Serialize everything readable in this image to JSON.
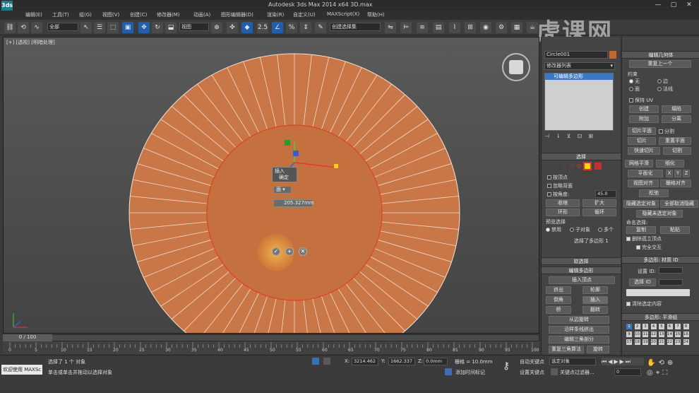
{
  "window": {
    "title": "Autodesk 3ds Max  2014 x64     3D.max",
    "logo": "3ds",
    "controls": [
      "—",
      "▢",
      "✕"
    ]
  },
  "menu": [
    "编辑(E)",
    "工具(T)",
    "组(G)",
    "视图(V)",
    "创建(C)",
    "修改器(M)",
    "动画(A)",
    "图形编辑器(D)",
    "渲染(R)",
    "自定义(U)",
    "MAXScript(X)",
    "帮助(H)"
  ],
  "toolbar": {
    "filter_select": "全部",
    "ref_coord_select": "视图",
    "named_set_select": "创建选择集",
    "snap_labels": [
      "2.5",
      "%"
    ]
  },
  "watermark": "虎课网",
  "viewport": {
    "label": "[+] [透视] [明暗处理]",
    "caddy": {
      "insert_title": "插入",
      "insert_sub": "确定",
      "type_value": "面",
      "amount_value": "205.327mm",
      "ok": "✓",
      "apply": "+",
      "cancel": "✕"
    }
  },
  "timeline": {
    "frame": "0 / 100",
    "ticks": [
      "0",
      "5",
      "10",
      "15",
      "20",
      "25",
      "30",
      "35",
      "40",
      "45",
      "50",
      "55",
      "60",
      "65",
      "70",
      "75",
      "80",
      "85",
      "90",
      "95",
      "100"
    ]
  },
  "status": {
    "welcome": "欢迎使用 MAXSc",
    "line1": "选择了 1 个 对象",
    "line2": "单击或单击并拖动以选择对象",
    "x_label": "X:",
    "x_value": "3214.462",
    "y_label": "Y:",
    "y_value": "1662.337",
    "z_label": "Z:",
    "z_value": "0.0mm",
    "grid": "栅格 = 10.0mm",
    "auto_key": "自动关键点",
    "set_key": "设置关键点",
    "key_select": "选定对象",
    "key_filters": "关键点过滤器...",
    "add_tag": "添加时间标记",
    "frame_field": "0"
  },
  "command_panel": {
    "object_name": "Circle001",
    "modifier_list": "修改器列表",
    "stack_item": "可编辑多边形",
    "selection": {
      "title": "选择",
      "by_vertex": "按顶点",
      "ignore_backfacing": "忽略背面",
      "by_angle": "按角度:",
      "angle_value": "45.0",
      "shrink": "收缩",
      "grow": "扩大",
      "ring": "环形",
      "loop": "循环",
      "preview_label": "预览选择",
      "preview_off": "禁用",
      "preview_sub": "子对象",
      "preview_multi": "多个",
      "summary": "选择了多边形 1"
    },
    "soft_selection": "软选择",
    "edit_polygons": {
      "title": "编辑多边形",
      "insert_vertex": "插入顶点",
      "extrude": "挤出",
      "outline": "轮廓",
      "bevel": "倒角",
      "inset": "插入",
      "bridge": "桥",
      "flip": "翻转",
      "hinge": "从边旋转",
      "extrude_spline": "沿样条线挤出",
      "edit_tri": "编辑三角剖分",
      "retriangulate": "重复三角算法",
      "turn": "旋转"
    }
  },
  "ribbon": {
    "edit_geometry": "编辑几何体",
    "repeat_last": "重复上一个",
    "constraints_label": "约束",
    "c_none": "无",
    "c_edge": "边",
    "c_face": "面",
    "c_normal": "法线",
    "preserve_uv": "保持 UV",
    "create": "创建",
    "collapse": "塌陷",
    "attach": "附加",
    "detach": "分离",
    "slice_plane": "切片平面",
    "split": "分割",
    "slice": "切片",
    "reset_plane": "重置平面",
    "quickslice": "快速切片",
    "cut": "切割",
    "msmooth": "网格平滑",
    "tessellate": "细化",
    "planarize": "平面化",
    "x": "X",
    "y": "Y",
    "z": "Z",
    "view_align": "视图对齐",
    "grid_align": "栅格对齐",
    "relax": "松弛",
    "hide_sel": "隐藏选定对象",
    "unhide_all": "全部取消隐藏",
    "hide_unsel": "隐藏未选定对象",
    "named_sel": "命名选择:",
    "copy": "复制",
    "paste": "粘贴",
    "delete_iso": "删除孤立顶点",
    "full_interact": "完全交互",
    "mat_title": "多边形: 材质 ID",
    "set_id": "设置 ID:",
    "select_id": "选择 ID",
    "clear_sel": "清除选定内容",
    "smooth_title": "多边形: 平滑组",
    "smooth_groups": [
      "1",
      "2",
      "3",
      "4",
      "5",
      "6",
      "7",
      "8",
      "9",
      "10",
      "11",
      "12",
      "13",
      "14",
      "15",
      "16",
      "17",
      "18",
      "19",
      "20",
      "21",
      "22",
      "23",
      "24"
    ]
  }
}
